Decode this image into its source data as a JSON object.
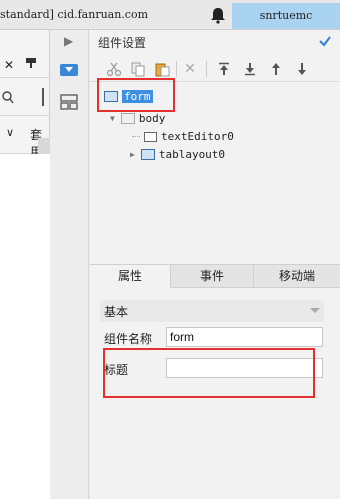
{
  "topbar": {
    "title": "standard] cid.fanruan.com",
    "user": "snrtuemc"
  },
  "left_pane": {
    "menu_label": "套用"
  },
  "panel": {
    "title": "组件设置",
    "tree": {
      "root": "form",
      "body": "body",
      "children": [
        "textEditor0",
        "tablayout0"
      ]
    },
    "tabs": [
      "属性",
      "事件",
      "移动端"
    ],
    "section": "基本",
    "props": {
      "name_label": "组件名称",
      "name_value": "form",
      "title_label": "标题",
      "title_value": ""
    }
  },
  "colors": {
    "highlight_red": "#e53030",
    "selection_blue": "#3d8fe0",
    "user_bg": "#a9d3f0"
  }
}
